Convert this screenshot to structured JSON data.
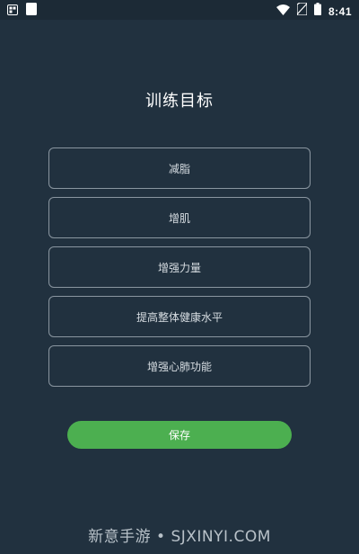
{
  "status_bar": {
    "time": "8:41",
    "left_icons": [
      "notification-icon",
      "clipboard-icon"
    ],
    "right_icons": [
      "wifi-icon",
      "no-sim-icon",
      "battery-icon"
    ]
  },
  "title": "训练目标",
  "options": [
    {
      "label": "减脂"
    },
    {
      "label": "增肌"
    },
    {
      "label": "增强力量"
    },
    {
      "label": "提高整体健康水平"
    },
    {
      "label": "增强心肺功能"
    }
  ],
  "save_button": {
    "label": "保存"
  },
  "watermark": "新意手游 • SJXINYI.COM",
  "colors": {
    "background": "#21313f",
    "accent": "#4caf50",
    "option_border": "#8a96a0"
  }
}
